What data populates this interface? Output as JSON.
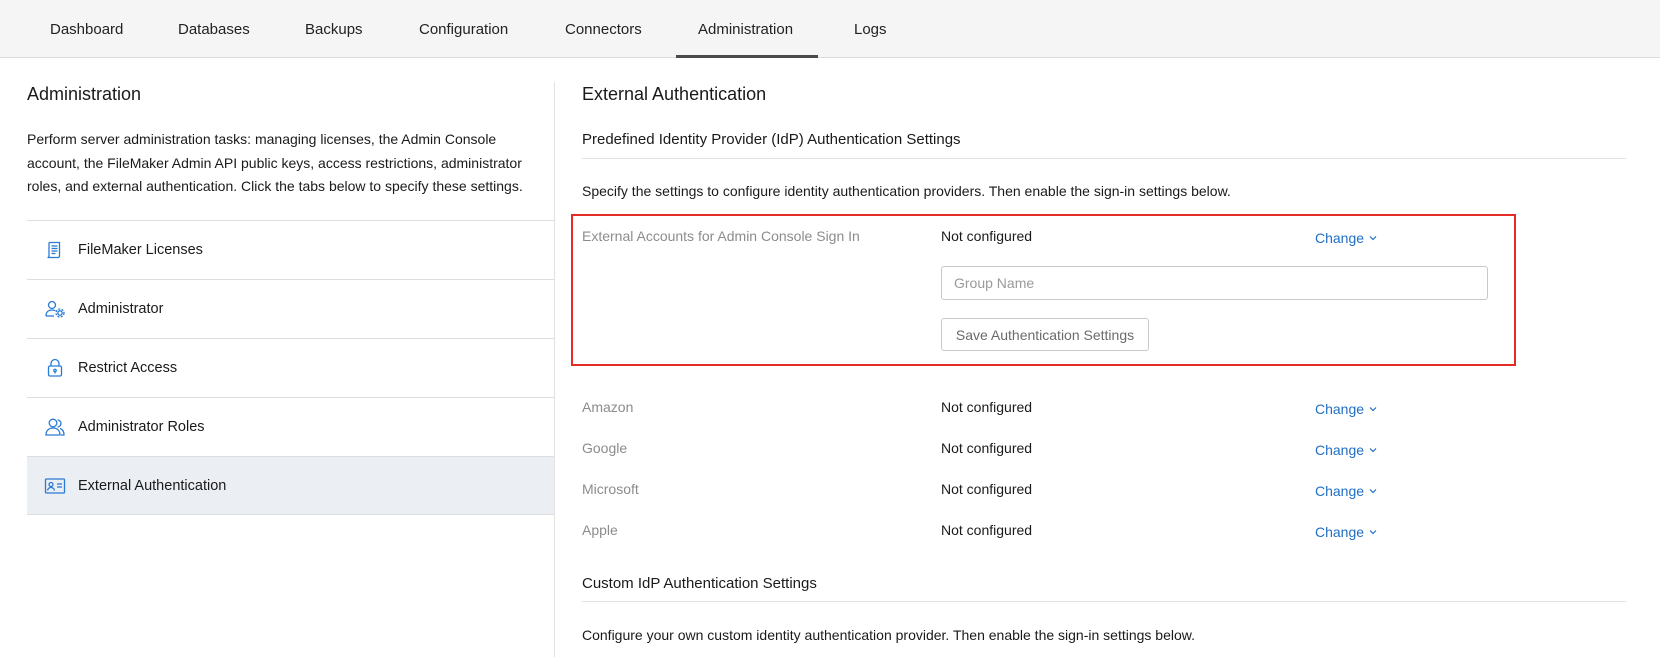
{
  "nav": {
    "tabs": [
      {
        "label": "Dashboard"
      },
      {
        "label": "Databases"
      },
      {
        "label": "Backups"
      },
      {
        "label": "Configuration"
      },
      {
        "label": "Connectors"
      },
      {
        "label": "Administration",
        "active": true
      },
      {
        "label": "Logs"
      }
    ]
  },
  "sidebar": {
    "title": "Administration",
    "description": "Perform server administration tasks: managing licenses, the Admin Console account, the FileMaker Admin API public keys, access restrictions, administrator roles, and external authentication. Click the tabs below to specify these settings.",
    "items": [
      {
        "label": "FileMaker Licenses",
        "icon": "license-icon"
      },
      {
        "label": "Administrator",
        "icon": "administrator-icon"
      },
      {
        "label": "Restrict Access",
        "icon": "lock-icon"
      },
      {
        "label": "Administrator Roles",
        "icon": "administrator-roles-icon"
      },
      {
        "label": "External Authentication",
        "icon": "id-card-icon",
        "selected": true
      }
    ]
  },
  "main": {
    "title": "External Authentication",
    "predefined": {
      "heading": "Predefined Identity Provider (IdP) Authentication Settings",
      "description": "Specify the settings to configure identity authentication providers. Then enable the sign-in settings below.",
      "admin_signin": {
        "label": "External Accounts for Admin Console Sign In",
        "status": "Not configured",
        "change_label": "Change",
        "group_placeholder": "Group Name",
        "save_label": "Save Authentication Settings"
      },
      "providers": [
        {
          "label": "Amazon",
          "status": "Not configured",
          "change_label": "Change"
        },
        {
          "label": "Google",
          "status": "Not configured",
          "change_label": "Change"
        },
        {
          "label": "Microsoft",
          "status": "Not configured",
          "change_label": "Change"
        },
        {
          "label": "Apple",
          "status": "Not configured",
          "change_label": "Change"
        }
      ]
    },
    "custom": {
      "heading": "Custom IdP Authentication Settings",
      "description": "Configure your own custom identity authentication provider. Then enable the sign-in settings below."
    }
  },
  "colors": {
    "link": "#1f6fc5",
    "highlight_border": "#e52b25",
    "selected_bg": "#ebeef2",
    "icon_blue": "#2a7bd5"
  }
}
